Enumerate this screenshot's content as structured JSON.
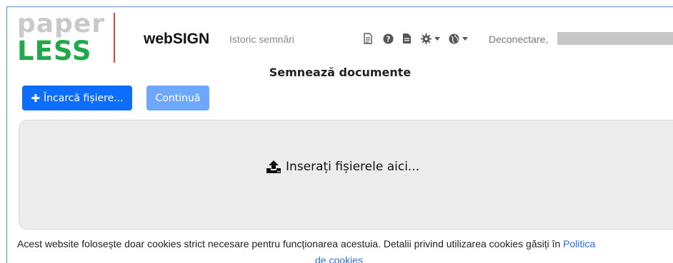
{
  "logo": {
    "word1": "paper",
    "word2": "LESS"
  },
  "nav": {
    "brand": "webSIGN",
    "history_link": "Istoric semnări",
    "logout_label": "Deconectare,",
    "icons": [
      "document-icon",
      "help-icon",
      "file-icon",
      "gear-icon",
      "globe-icon"
    ]
  },
  "page": {
    "title": "Semnează documente",
    "upload_button": "Încarcă fișiere...",
    "continue_button": "Continuă",
    "drop_label": "Inserați fișierele aici..."
  },
  "cookie": {
    "text": "Acest website folosește doar cookies strict necesare pentru funcționarea acestuia. Detalii privind utilizarea cookies găsiți în",
    "link_part1": "Politica",
    "link_part2": "de cookies"
  },
  "colors": {
    "accent": "#0d6efd",
    "accent_light": "#6ea8fe",
    "logo_green": "#21a84a",
    "logo_gray": "#c9c9c9",
    "divider_red": "#e04545",
    "link_blue": "#2a6fd6"
  }
}
